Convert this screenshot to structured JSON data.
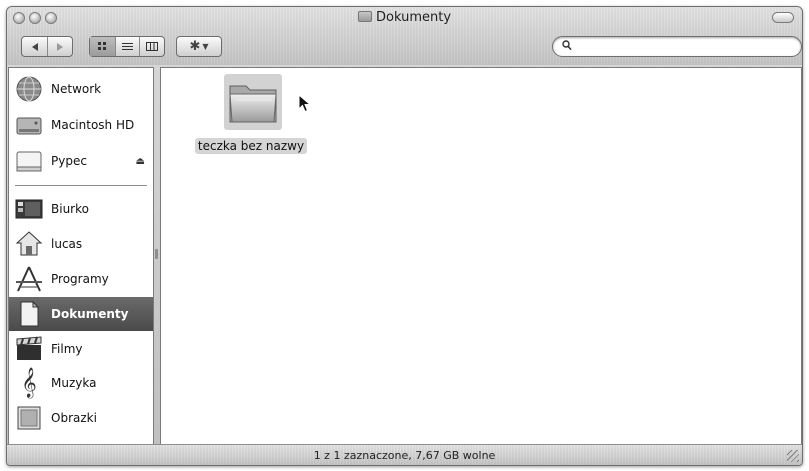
{
  "window": {
    "title": "Dokumenty"
  },
  "toolbar": {
    "back_icon": "back-arrow-icon",
    "forward_icon": "forward-arrow-icon",
    "view_icons": [
      "icon-view-icon",
      "list-view-icon",
      "column-view-icon"
    ],
    "action_icon": "gear-icon",
    "search_value": ""
  },
  "sidebar": {
    "devices": [
      {
        "label": "Network",
        "icon": "network-globe-icon"
      },
      {
        "label": "Macintosh HD",
        "icon": "hard-drive-icon"
      },
      {
        "label": "Pypec",
        "icon": "disk-icon",
        "eject": "⏏"
      }
    ],
    "places": [
      {
        "label": "Biurko",
        "icon": "desktop-icon"
      },
      {
        "label": "lucas",
        "icon": "home-icon"
      },
      {
        "label": "Programy",
        "icon": "applications-icon"
      },
      {
        "label": "Dokumenty",
        "icon": "documents-icon",
        "selected": true
      },
      {
        "label": "Filmy",
        "icon": "movies-clapper-icon"
      },
      {
        "label": "Muzyka",
        "icon": "music-note-icon"
      },
      {
        "label": "Obrazki",
        "icon": "pictures-icon"
      }
    ]
  },
  "content": {
    "items": [
      {
        "name": "teczka bez nazwy",
        "icon": "folder-icon",
        "selected": true
      }
    ]
  },
  "status": {
    "text": "1 z 1 zaznaczone, 7,67 GB wolne"
  },
  "colors": {
    "selection": "#5a5a5a",
    "chrome": "#cfcfcf"
  }
}
